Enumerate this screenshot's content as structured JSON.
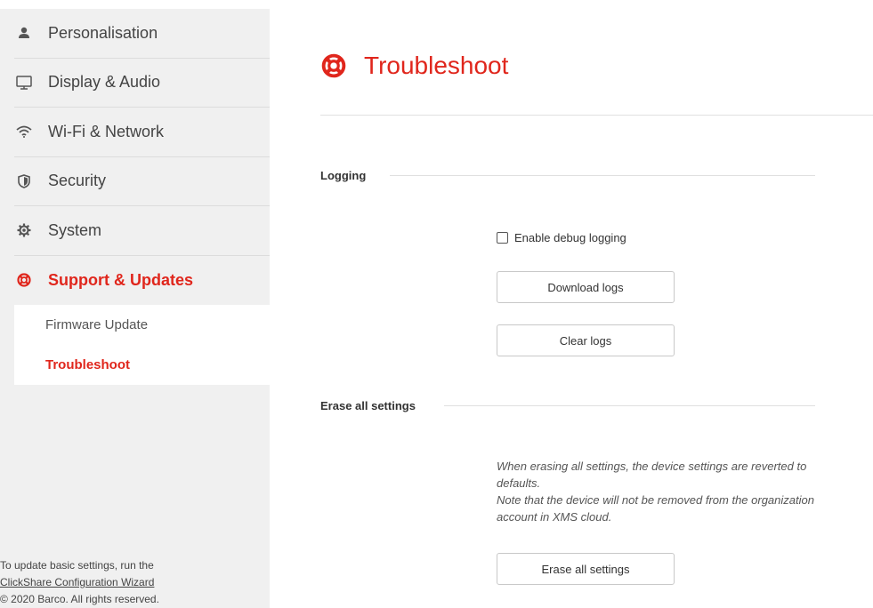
{
  "sidebar": {
    "items": [
      {
        "label": "Personalisation",
        "icon": "user-icon"
      },
      {
        "label": "Display & Audio",
        "icon": "monitor-icon"
      },
      {
        "label": "Wi-Fi & Network",
        "icon": "wifi-icon"
      },
      {
        "label": "Security",
        "icon": "shield-icon"
      },
      {
        "label": "System",
        "icon": "gear-icon"
      },
      {
        "label": "Support & Updates",
        "icon": "lifebuoy-icon",
        "active": true
      }
    ],
    "subitems": [
      {
        "label": "Firmware Update"
      },
      {
        "label": "Troubleshoot",
        "active": true
      }
    ],
    "footer": {
      "line1": "To update basic settings, run the",
      "link": "ClickShare Configuration Wizard",
      "copyright": "© 2020  Barco. All rights reserved."
    }
  },
  "main": {
    "title": "Troubleshoot",
    "logging": {
      "section_title": "Logging",
      "checkbox_label": "Enable debug logging",
      "checkbox_checked": false,
      "download_label": "Download logs",
      "clear_label": "Clear logs"
    },
    "erase": {
      "section_title": "Erase all settings",
      "note_line1": "When erasing all settings, the device settings are reverted to defaults.",
      "note_line2": "Note that the device will not be removed from the organization account in XMS cloud.",
      "button_label": "Erase all settings"
    }
  },
  "colors": {
    "accent": "#e0261c",
    "sidebar_bg": "#f0f0f0"
  }
}
